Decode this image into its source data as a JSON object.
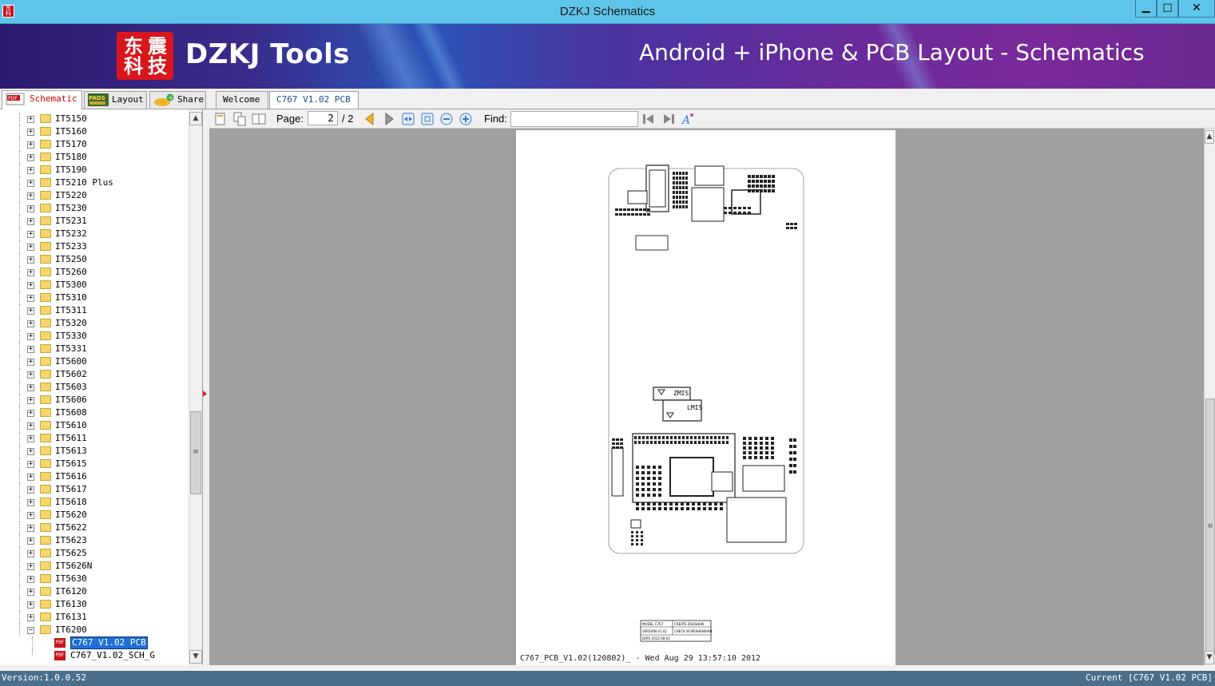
{
  "window": {
    "title": "DZKJ Schematics",
    "minimize": "▁",
    "maximize": "□",
    "close": "✕"
  },
  "banner": {
    "logo_chars": [
      "东",
      "震",
      "科",
      "技"
    ],
    "brand": "DZKJ Tools",
    "tagline": "Android + iPhone & PCB Layout - Schematics"
  },
  "mode_tabs": [
    {
      "label": "Schematic",
      "icon": "pdf-icon"
    },
    {
      "label": "Layout",
      "icon": "pads-icon"
    },
    {
      "label": "Share",
      "icon": "cloud-share-icon"
    }
  ],
  "doc_tabs": [
    {
      "label": "Welcome"
    },
    {
      "label": "C767 V1.02 PCB"
    }
  ],
  "tree": {
    "folders": [
      "IT5150",
      "IT5160",
      "IT5170",
      "IT5180",
      "IT5190",
      "IT5210 Plus",
      "IT5220",
      "IT5230",
      "IT5231",
      "IT5232",
      "IT5233",
      "IT5250",
      "IT5260",
      "IT5300",
      "IT5310",
      "IT5311",
      "IT5320",
      "IT5330",
      "IT5331",
      "IT5600",
      "IT5602",
      "IT5603",
      "IT5606",
      "IT5608",
      "IT5610",
      "IT5611",
      "IT5613",
      "IT5615",
      "IT5616",
      "IT5617",
      "IT5618",
      "IT5620",
      "IT5622",
      "IT5623",
      "IT5625",
      "IT5626N",
      "IT5630",
      "IT6120",
      "IT6130",
      "IT6131",
      "IT6200"
    ],
    "expanded_folder": "IT6200",
    "files": [
      "C767 V1.02 PCB",
      "C767_V1.02_SCH_G"
    ],
    "selected_file": "C767 V1.02 PCB"
  },
  "viewer_toolbar": {
    "page_label": "Page:",
    "page_current": "2",
    "page_total": "/ 2",
    "find_label": "Find:",
    "find_value": ""
  },
  "document": {
    "sim_labels": [
      "ZMIS",
      "LMIS"
    ],
    "footer": "C767_PCB_V1.02(120802)_ - Wed Aug 29 13:57:10 2012",
    "title_block": [
      "MODEL C767",
      "VERSION V1.02",
      "DATE 2012-08-02",
      "CREATE ZHUSHUN",
      "CHECK W WESHENXIAN"
    ]
  },
  "status": {
    "version": "Version:1.0.0.52",
    "current": "Current [C767 V1.02 PCB]"
  },
  "colors": {
    "titlebar": "#5ec4ea",
    "selection": "#1e6fd9",
    "statusbar": "#4a6f8c",
    "logo_red": "#d9161c"
  }
}
